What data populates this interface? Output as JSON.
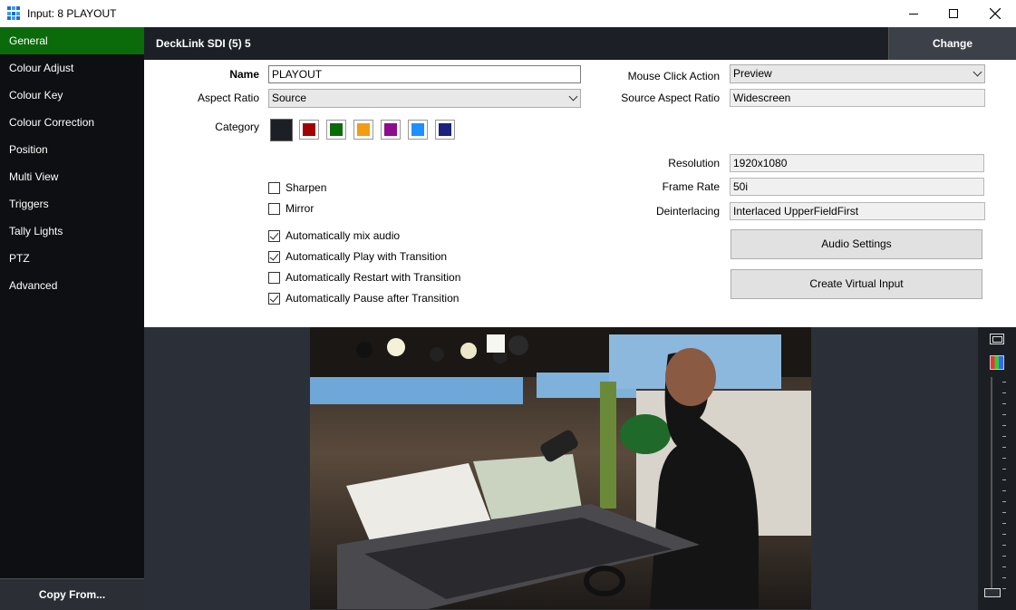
{
  "window": {
    "title": "Input: 8 PLAYOUT"
  },
  "sidebar": {
    "items": [
      {
        "label": "General",
        "active": true
      },
      {
        "label": "Colour Adjust"
      },
      {
        "label": "Colour Key"
      },
      {
        "label": "Colour Correction"
      },
      {
        "label": "Position"
      },
      {
        "label": "Multi View"
      },
      {
        "label": "Triggers"
      },
      {
        "label": "Tally Lights"
      },
      {
        "label": "PTZ"
      },
      {
        "label": "Advanced"
      }
    ],
    "copy_from": "Copy From..."
  },
  "header": {
    "title": "DeckLink SDI (5) 5",
    "change_label": "Change"
  },
  "form": {
    "name_label": "Name",
    "name_value": "PLAYOUT",
    "aspect_label": "Aspect Ratio",
    "aspect_value": "Source",
    "category_label": "Category",
    "category_colors": [
      "#1c2026",
      "#a00000",
      "#0b6b0b",
      "#f39c12",
      "#8e0b8e",
      "#1e90ff",
      "#1a237e"
    ],
    "mouse_click_label": "Mouse Click Action",
    "mouse_click_value": "Preview",
    "source_aspect_label": "Source Aspect Ratio",
    "source_aspect_value": "Widescreen",
    "resolution_label": "Resolution",
    "resolution_value": "1920x1080",
    "frame_rate_label": "Frame Rate",
    "frame_rate_value": "50i",
    "deinterlacing_label": "Deinterlacing",
    "deinterlacing_value": "Interlaced UpperFieldFirst",
    "checkboxes": [
      {
        "label": "Sharpen",
        "checked": false
      },
      {
        "label": "Mirror",
        "checked": false
      },
      {
        "label": "Automatically mix audio",
        "checked": true
      },
      {
        "label": "Automatically Play with Transition",
        "checked": true
      },
      {
        "label": "Automatically Restart with Transition",
        "checked": false
      },
      {
        "label": "Automatically Pause after Transition",
        "checked": true
      }
    ],
    "audio_settings_label": "Audio Settings",
    "create_virtual_label": "Create Virtual Input"
  }
}
